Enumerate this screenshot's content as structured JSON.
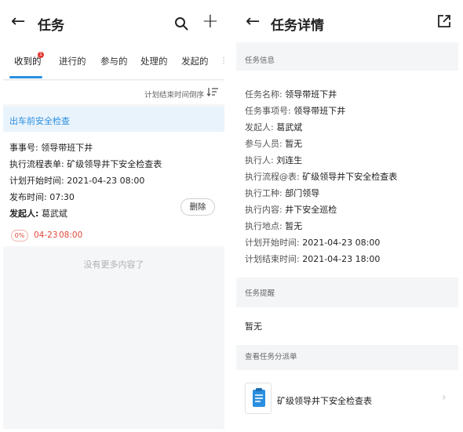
{
  "left": {
    "title": "任务",
    "tabs": [
      "收到的",
      "进行的",
      "参与的",
      "处理的",
      "发起的"
    ],
    "tab_badge": "1",
    "tab_more": "⋮",
    "sort_label": "计划结束时间倒序",
    "task": {
      "group_title": "出车前安全检查",
      "rows": [
        {
          "key": "事事号",
          "value": "领导带班下井"
        },
        {
          "key": "执行流程表单",
          "value": "矿级领导井下安全检查表"
        },
        {
          "key": "计划开始时间",
          "value": "2021-04-23 08:00"
        },
        {
          "key": "发布时间",
          "value": "07:30"
        },
        {
          "key": "发起人",
          "value": "葛武斌"
        }
      ],
      "delete_label": "删除",
      "progress": "0%",
      "end_date": "04-23",
      "end_time": "08:00"
    },
    "no_more_text": "没有更多内容了"
  },
  "right": {
    "title": "任务详情",
    "section_info": "任务信息",
    "info_rows": [
      {
        "key": "任务名称",
        "value": "领导带班下井"
      },
      {
        "key": "任务事项号",
        "value": "领导带班下井"
      },
      {
        "key": "发起人",
        "value": "葛武斌"
      },
      {
        "key": "参与人员",
        "value": "暂无"
      },
      {
        "key": "执行人",
        "value": "刘连生"
      },
      {
        "key": "执行流程@表",
        "value": "矿级领导井下安全检查表"
      },
      {
        "key": "执行工种",
        "value": "部门领导"
      },
      {
        "key": "执行内容",
        "value": "井下安全巡检"
      },
      {
        "key": "执行地点",
        "value": "暂无"
      },
      {
        "key": "计划开始时间",
        "value": "2021-04-23 08:00"
      },
      {
        "key": "计划结束时间",
        "value": "2021-04-23 18:00"
      }
    ],
    "section_remind": "任务提醒",
    "remind_value": "暂无",
    "section_dispatch": "查看任务分派单",
    "dispatch_item": "矿级领导井下安全检查表"
  },
  "colors": {
    "accent": "#2a8fe0",
    "danger": "#e0463a",
    "badge": "#e53935"
  }
}
